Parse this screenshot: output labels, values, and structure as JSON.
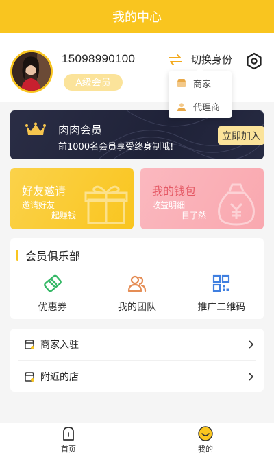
{
  "header": {
    "title": "我的中心"
  },
  "profile": {
    "phone": "15098990100",
    "level": "A级会员",
    "switch_label": "切换身份",
    "role_options": [
      "商家",
      "代理商"
    ]
  },
  "vip": {
    "title": "肉肉会员",
    "desc": "前1000名会员享受终身制哦!",
    "button": "立即加入"
  },
  "promos": [
    {
      "title": "好友邀请",
      "line1": "邀请好友",
      "line2": "一起赚钱"
    },
    {
      "title": "我的钱包",
      "line1": "收益明细",
      "line2": "一目了然"
    }
  ],
  "club": {
    "title": "会员俱乐部",
    "items": [
      {
        "label": "优惠券",
        "icon": "coupon-icon"
      },
      {
        "label": "我的团队",
        "icon": "team-icon"
      },
      {
        "label": "推广二维码",
        "icon": "qrcode-icon"
      }
    ]
  },
  "list": [
    {
      "label": "商家入驻",
      "icon": "shop-icon"
    },
    {
      "label": "附近的店",
      "icon": "store-nearby-icon"
    }
  ],
  "tabs": [
    {
      "label": "首页",
      "icon": "home-icon"
    },
    {
      "label": "我的",
      "icon": "smile-icon"
    }
  ],
  "colors": {
    "accent": "#f9c51f",
    "vip_bg": "#22253c",
    "wallet_pink": "#f9a8af"
  }
}
